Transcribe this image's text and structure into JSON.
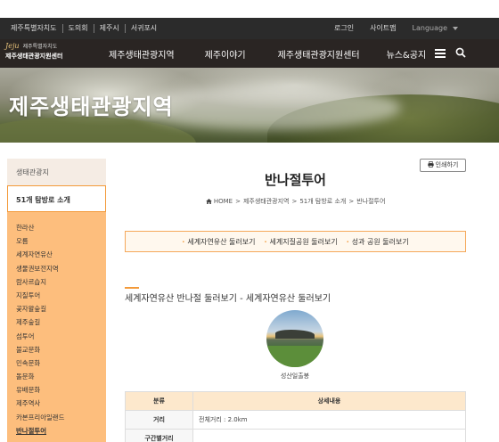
{
  "utilbar": {
    "links": [
      "제주특별자치도",
      "도의회",
      "제주시",
      "서귀포시"
    ],
    "login": "로그인",
    "sitemap": "사이트맵",
    "language": "Language"
  },
  "header": {
    "logo_brand": "Jeju",
    "logo_line1": "제주특별자치도",
    "logo_line2": "제주생태관광지원센터",
    "nav": [
      "제주생태관광지역",
      "제주이야기",
      "제주생태관광지원센터",
      "뉴스&공지"
    ]
  },
  "hero": {
    "title": "제주생태관광지역"
  },
  "sidebar": {
    "heading": "생태관광지",
    "active": "51개 탐방로 소개",
    "items": [
      "한라산",
      "오름",
      "세계자연유산",
      "생물권보전지역",
      "람사르습지",
      "지질투어",
      "곶자왈숲길",
      "제주숲길",
      "섬투어",
      "불교문화",
      "민속문화",
      "돌문화",
      "유배문화",
      "제주역사",
      "카본프리아일랜드",
      "반나절투어"
    ],
    "current_index": 15
  },
  "main": {
    "print_label": "인쇄하기",
    "title": "반나절투어",
    "breadcrumb": [
      "HOME",
      "제주생태관광지역",
      "51개 탐방로 소개",
      "반나절투어"
    ],
    "tabs": [
      "세계자연유산 둘러보기",
      "세계지질공원 둘러보기",
      "성과 공원 둘러보기"
    ],
    "section_title": "세계자연유산 반나절 둘러보기 - 세계자연유산 둘러보기",
    "photo_caption": "성산일출봉",
    "table": {
      "headers": [
        "분류",
        "상세내용"
      ],
      "rows": [
        {
          "key": "거리",
          "value": "전체거리 : 2.0km"
        },
        {
          "key": "구간별거리",
          "value": ""
        }
      ]
    }
  },
  "colors": {
    "accent": "#f39a3a",
    "sidebar_bg": "#fdbe7d",
    "nav_bg": "#2a2523"
  }
}
